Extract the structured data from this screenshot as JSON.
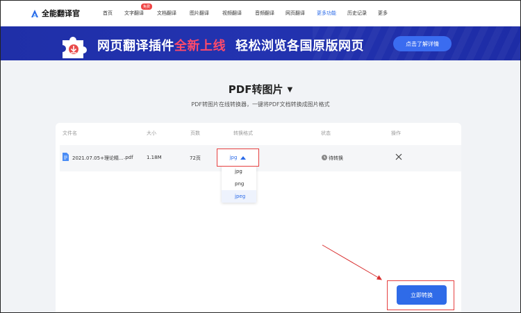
{
  "app": {
    "name": "全能翻译官"
  },
  "nav": {
    "items": [
      {
        "label": "首页"
      },
      {
        "label": "文字翻译",
        "badge": "免费"
      },
      {
        "label": "文档翻译"
      },
      {
        "label": "图片翻译"
      },
      {
        "label": "视频翻译"
      },
      {
        "label": "音频翻译"
      },
      {
        "label": "网页翻译"
      },
      {
        "label": "更多功能",
        "active": true
      },
      {
        "label": "历史记录"
      },
      {
        "label": "更多"
      }
    ]
  },
  "banner": {
    "text_part1": "网页翻译插件",
    "text_highlight": "全新上线",
    "text_part2": "轻松浏览各国原版网页",
    "button": "点击了解详情",
    "icon": "puzzle-icon"
  },
  "page": {
    "title": "PDF转图片",
    "subtitle": "PDF转图片在线转换器，一键将PDF文档转换成图片格式"
  },
  "table": {
    "headers": {
      "filename": "文件名",
      "size": "大小",
      "pages": "页数",
      "format": "转换格式",
      "status": "状态",
      "action": "操作"
    },
    "rows": [
      {
        "filename": "2021.07.05+理论精...",
        "ext": ".pdf",
        "size": "1.18M",
        "pages": "72页",
        "format": "jpg",
        "status": "待转换"
      }
    ]
  },
  "format_dropdown": {
    "options": [
      "jpg",
      "png",
      "jpeg"
    ],
    "highlighted": "jpeg"
  },
  "convert_button": "立即转换",
  "colors": {
    "accent": "#2f6be8",
    "banner": "#1f2fa8",
    "highlight": "#ff4a6a",
    "annotation": "#e53e3e"
  }
}
